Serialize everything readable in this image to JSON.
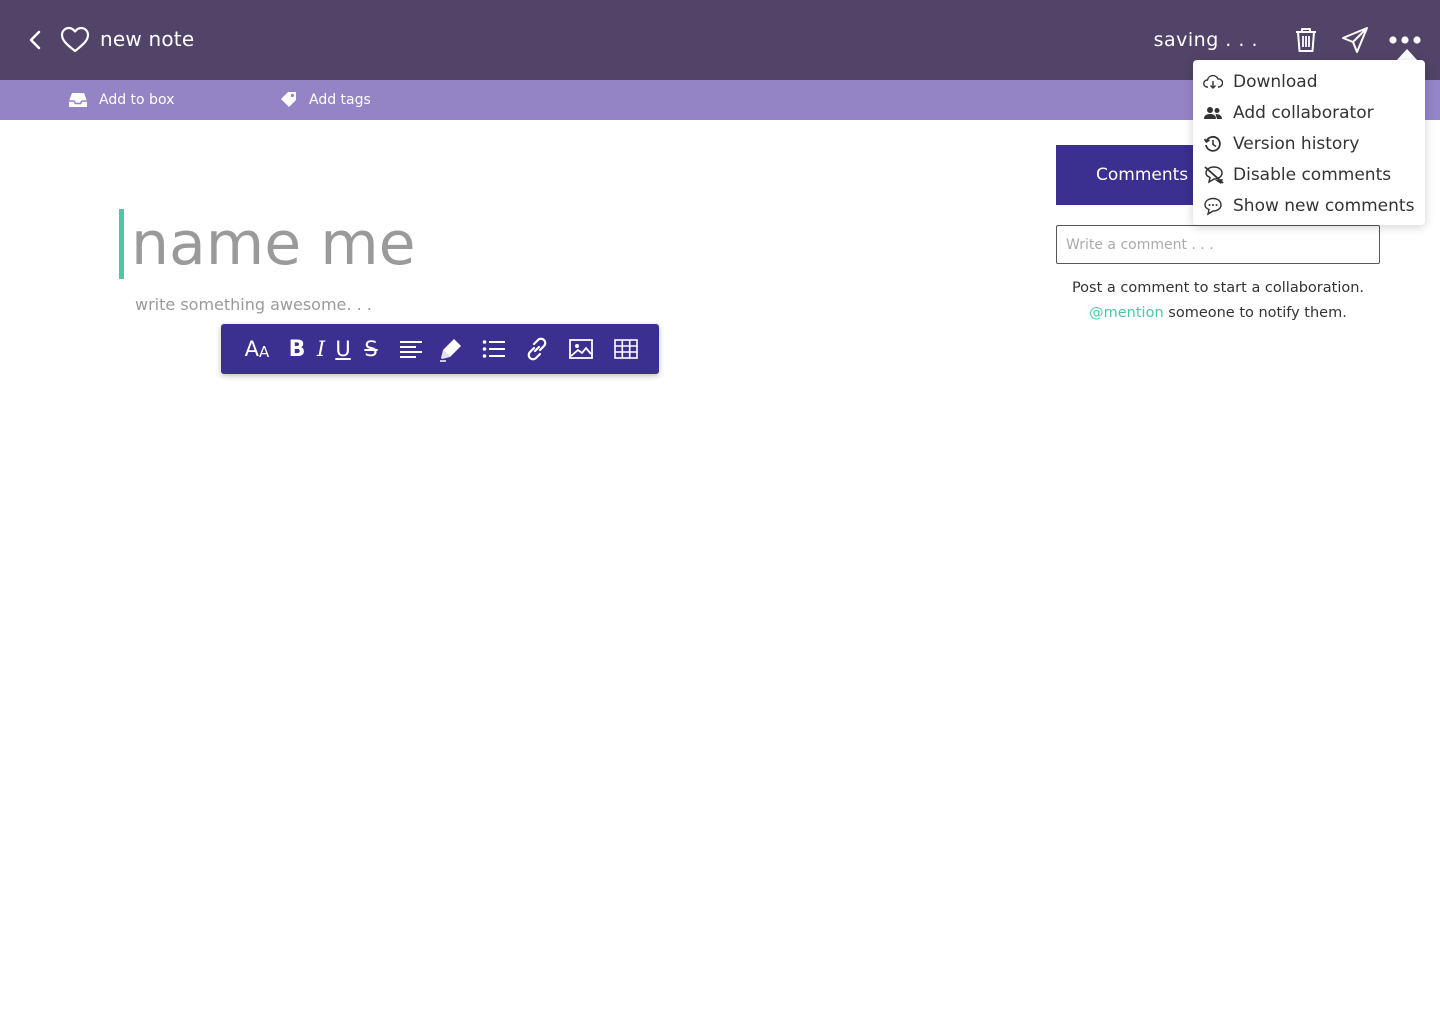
{
  "header": {
    "title": "new note",
    "status": "saving . . ."
  },
  "subbar": {
    "add_to_box": "Add to box",
    "add_tags": "Add tags"
  },
  "editor": {
    "title_placeholder": "name me",
    "body_placeholder": "write something awesome. . ."
  },
  "toolbar": {
    "font_size_big": "A",
    "font_size_small": "A",
    "bold": "B",
    "italic": "I",
    "underline": "U",
    "strike": "S"
  },
  "comments": {
    "tab_label": "Comments",
    "input_placeholder": "Write a comment . . .",
    "hint_line1": "Post a comment to start a collaboration.",
    "hint_mention": "@mention",
    "hint_line2_rest": " someone to notify them."
  },
  "menu": {
    "items": [
      {
        "label": "Download",
        "icon": "cloud-download-icon"
      },
      {
        "label": "Add collaborator",
        "icon": "people-icon"
      },
      {
        "label": "Version history",
        "icon": "history-icon"
      },
      {
        "label": "Disable comments",
        "icon": "comment-off-icon"
      },
      {
        "label": "Show new comments",
        "icon": "comment-icon"
      }
    ]
  },
  "colors": {
    "topbar": "#524368",
    "subbar": "#9484c5",
    "toolbar": "#3b2f8f",
    "accent": "#4fc6a5"
  }
}
